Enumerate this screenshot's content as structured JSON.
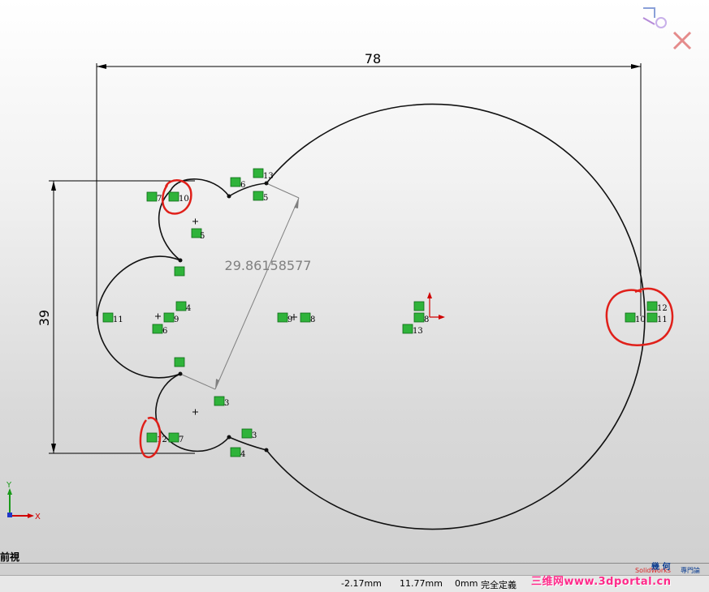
{
  "sketch": {
    "dim_width": "78",
    "dim_height": "39",
    "dim_diagonal": "29.86158577",
    "relations": [
      {
        "label": "6"
      },
      {
        "label": "13"
      },
      {
        "label": "5"
      },
      {
        "label": "7"
      },
      {
        "label": "10"
      },
      {
        "label": "5"
      },
      {
        "label": ""
      },
      {
        "label": "4"
      },
      {
        "label": "11"
      },
      {
        "label": "9"
      },
      {
        "label": "6"
      },
      {
        "label": "9"
      },
      {
        "label": "8"
      },
      {
        "label": "8"
      },
      {
        "label": "13"
      },
      {
        "label": "12"
      },
      {
        "label": "10"
      },
      {
        "label": "11"
      },
      {
        "label": ""
      },
      {
        "label": "3"
      },
      {
        "label": "12"
      },
      {
        "label": "7"
      },
      {
        "label": "3"
      },
      {
        "label": "4"
      }
    ],
    "triad": {
      "x_label": "X",
      "y_label": "Y"
    }
  },
  "view_name": "前視",
  "status": {
    "x": "-2.17mm",
    "y": "11.77mm",
    "z": "0mm",
    "state": "完全定義"
  },
  "watermark": "三维网www.3dportal.cn",
  "logo": {
    "line1": "幾 何",
    "line2": "SolidWorks",
    "line3": "專門論壇"
  },
  "colors": {
    "relation": "#2fb33a",
    "annotation": "#e0201a",
    "axis_x": "#d00000",
    "axis_y": "#1a9a1a"
  }
}
